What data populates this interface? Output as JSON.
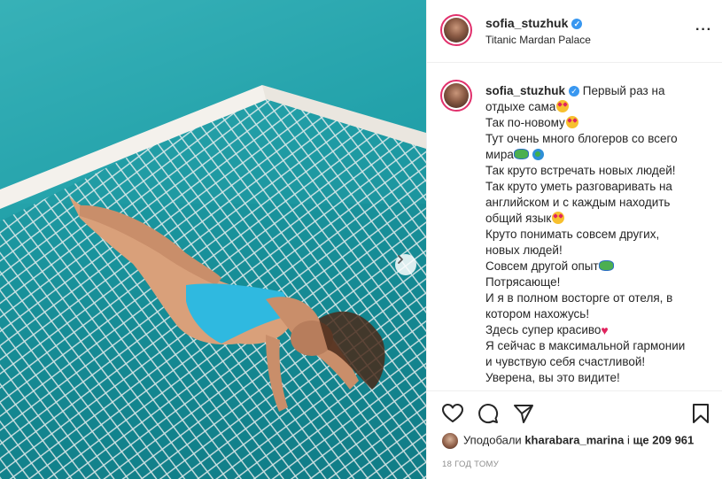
{
  "post": {
    "username": "sofia_stuzhuk",
    "location": "Titanic Mardan Palace",
    "caption_lines": [
      "Первый раз на",
      "отдыхе сама",
      "Так по-новому",
      "Тут очень много блогеров со всего",
      "мира",
      "Так круто встречать новых людей!",
      "Так круто уметь разговаривать на",
      "английском и с каждым находить",
      "общий язык",
      "Круто понимать совсем других,",
      "новых людей!",
      "Совсем другой опыт",
      "Потрясающе!",
      "И я в полном восторге от отеля, в",
      "котором нахожусь!",
      "Здесь супер красиво",
      "Я сейчас в максимальной гармонии",
      "и чувствую себя счастливой!",
      "Уверена, вы это видите!"
    ],
    "likes_prefix": "Уподобали ",
    "likes_user": "kharabara_marina",
    "likes_middle": " і ",
    "likes_count": "ще 209 961",
    "timestamp": "18 ГОД ТОМУ"
  },
  "icons": {
    "verified": "verified-badge-icon",
    "more": "more-options-icon",
    "next": "chevron-right-icon",
    "like": "heart-icon",
    "comment": "comment-icon",
    "share": "share-icon",
    "save": "bookmark-icon"
  },
  "colors": {
    "verified_blue": "#3897f0",
    "story_ring": "#e1306c",
    "water": "#1f9ea7"
  }
}
